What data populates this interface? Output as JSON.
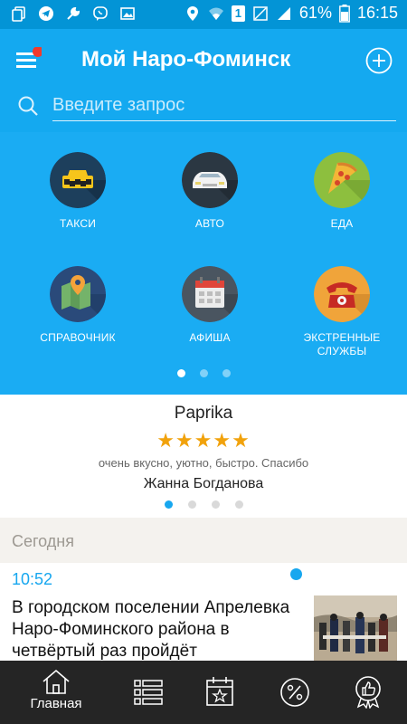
{
  "status_bar": {
    "battery": "61%",
    "time": "16:15",
    "sim_slot": "1"
  },
  "header": {
    "title": "Мой Наро-Фоминск",
    "search_placeholder": "Введите запрос"
  },
  "categories": [
    {
      "label": "ТАКСИ",
      "icon": "taxi-icon"
    },
    {
      "label": "АВТО",
      "icon": "car-icon"
    },
    {
      "label": "ЕДА",
      "icon": "pizza-icon"
    },
    {
      "label": "СПРАВОЧНИК",
      "icon": "map-pin-icon"
    },
    {
      "label": "АФИША",
      "icon": "calendar-icon"
    },
    {
      "label": "ЭКСТРЕННЫЕ СЛУЖБЫ",
      "icon": "phone-icon"
    }
  ],
  "categories_page": {
    "current": 1,
    "total": 3
  },
  "review": {
    "place": "Paprika",
    "rating": 5,
    "stars": "★★★★★",
    "text": "очень вкусно, уютно, быстро. Спасибо",
    "author": "Жанна Богданова",
    "page": {
      "current": 1,
      "total": 4
    }
  },
  "news_section": {
    "day": "Сегодня",
    "items": [
      {
        "time": "10:52",
        "text": "В городском поселении Апрелевка Наро-Фоминского района в четвёртый раз пройдёт"
      }
    ]
  },
  "bottom_nav": {
    "items": [
      {
        "label": "Главная",
        "icon": "home-icon",
        "active": true
      },
      {
        "label": "",
        "icon": "list-icon"
      },
      {
        "label": "",
        "icon": "calendar-star-icon"
      },
      {
        "label": "",
        "icon": "percent-icon"
      },
      {
        "label": "",
        "icon": "thumbs-up-badge-icon"
      }
    ]
  },
  "colors": {
    "status_bar": "#0394d6",
    "header": "#14a9f0",
    "grid": "#1aacf3",
    "accent": "#17a7ef",
    "star": "#f1a20c",
    "bottom_nav": "#252525"
  }
}
